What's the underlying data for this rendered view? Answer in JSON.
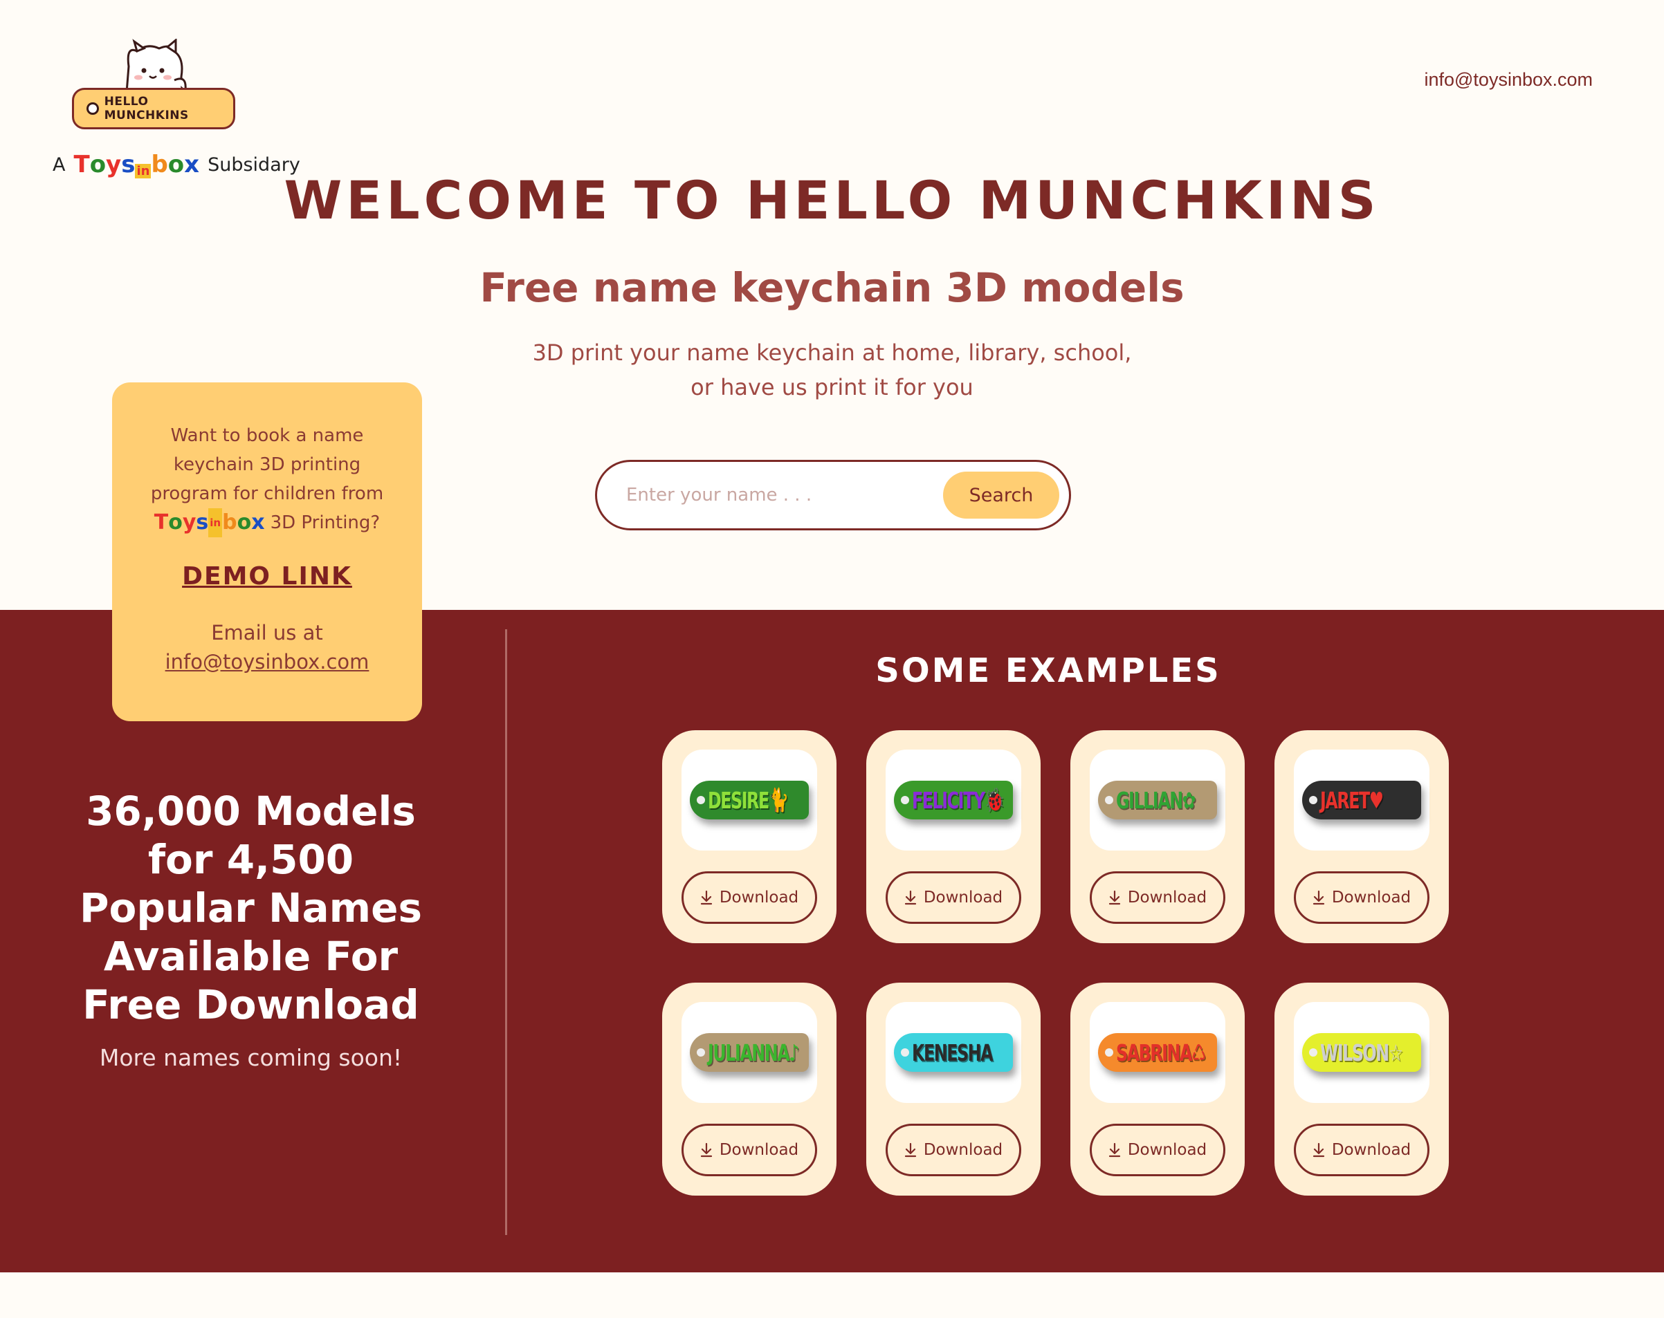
{
  "header": {
    "logo_text": "HELLO MUNCHKINS",
    "subsidiary_prefix": "A",
    "brand_logo_text": "Toysinbox",
    "subsidiary_suffix": "Subsidary",
    "email": "info@toysinbox.com"
  },
  "hero": {
    "title": "Welcome to Hello Munchkins",
    "subtitle": "Free name keychain 3D models",
    "desc_line1": "3D print your name keychain at home, library, school,",
    "desc_line2": "or have us print it for you"
  },
  "search": {
    "placeholder": "Enter your name . . .",
    "button_label": "Search"
  },
  "promo": {
    "line1": "Want to book a name",
    "line2": "keychain 3D printing",
    "line3": "program for children from",
    "line4_suffix": "3D Printing?",
    "demo_link": "Demo Link",
    "email_label": "Email us at",
    "email": "info@toysinbox.com"
  },
  "stats": {
    "line1": "36,000 Models",
    "line2": "for 4,500",
    "line3": "Popular Names",
    "line4": "Available For",
    "line5": "Free Download",
    "sub": "More names coming soon!"
  },
  "examples": {
    "title": "Some Examples",
    "download_label": "Download",
    "items": [
      {
        "name": "DESIRE",
        "symbol": "🐈",
        "base_color": "#2f8a2c",
        "text_color": "#8fe03a"
      },
      {
        "name": "FELICITY",
        "symbol": "🐞",
        "base_color": "#3a9a2a",
        "text_color": "#8a2cd6"
      },
      {
        "name": "GILLIAN",
        "symbol": "✿",
        "base_color": "#b39a73",
        "text_color": "#2fa434"
      },
      {
        "name": "JARET",
        "symbol": "♥",
        "base_color": "#2e2e2e",
        "text_color": "#e8322c"
      },
      {
        "name": "JULIANNA",
        "symbol": "♪",
        "base_color": "#b39a73",
        "text_color": "#3bb52e"
      },
      {
        "name": "KENESHA",
        "symbol": "",
        "base_color": "#3ed3de",
        "text_color": "#2a2a2a"
      },
      {
        "name": "SABRINA",
        "symbol": "♺",
        "base_color": "#f58a2c",
        "text_color": "#e2302a"
      },
      {
        "name": "WILSON",
        "symbol": "☆",
        "base_color": "#e4ef2c",
        "text_color": "#cfcfcf"
      }
    ]
  }
}
